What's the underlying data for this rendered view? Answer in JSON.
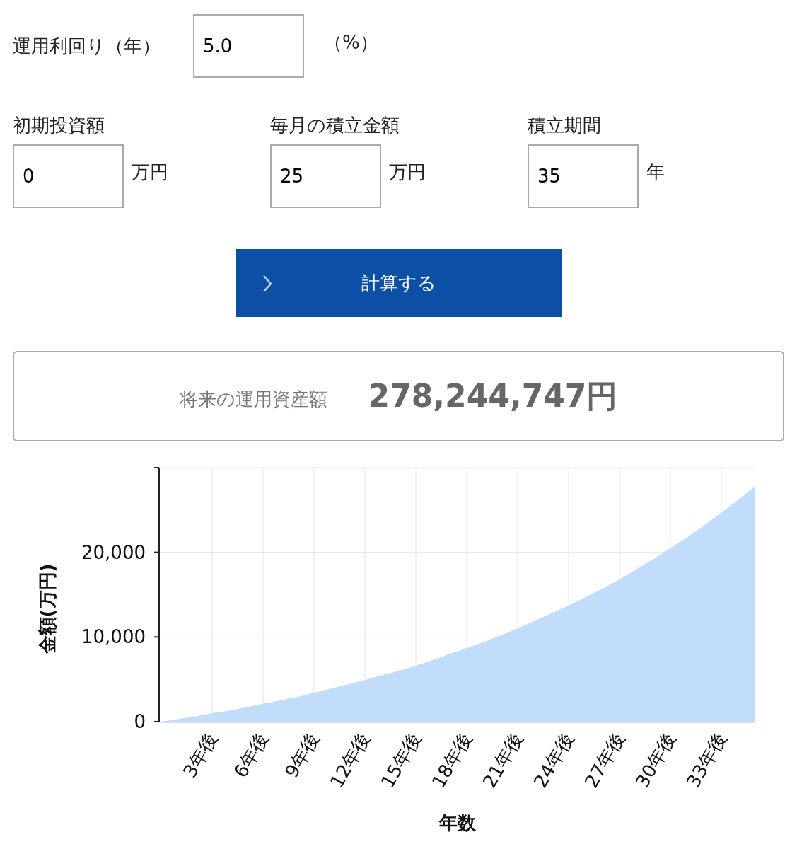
{
  "rate": {
    "label": "運用利回り（年）",
    "value": "5.0",
    "unit": "（%）"
  },
  "fields": [
    {
      "label": "初期投資額",
      "value": "0",
      "unit": "万円"
    },
    {
      "label": "毎月の積立金額",
      "value": "25",
      "unit": "万円"
    },
    {
      "label": "積立期間",
      "value": "35",
      "unit": "年"
    }
  ],
  "button": {
    "label": "計算する"
  },
  "result": {
    "label": "将来の運用資産額",
    "value": "278,244,747円"
  },
  "chart_data": {
    "type": "area",
    "xlabel": "年数",
    "ylabel": "金額(万円)",
    "x": [
      0,
      1,
      2,
      3,
      4,
      5,
      6,
      7,
      8,
      9,
      10,
      11,
      12,
      13,
      14,
      15,
      16,
      17,
      18,
      19,
      20,
      21,
      22,
      23,
      24,
      25,
      26,
      27,
      28,
      29,
      30,
      31,
      32,
      33,
      34,
      35
    ],
    "series": [
      {
        "color": "#c2dcfb",
        "values": [
          0,
          300,
          600,
          1000,
          1300,
          1700,
          2100,
          2500,
          2900,
          3400,
          3900,
          4400,
          4900,
          5500,
          6000,
          6600,
          7300,
          8000,
          8700,
          9400,
          10200,
          11000,
          11900,
          12800,
          13700,
          14700,
          15700,
          16800,
          18000,
          19200,
          20500,
          21800,
          23200,
          24700,
          26200,
          27800
        ]
      }
    ],
    "grid": true,
    "xlim": [
      0,
      35
    ],
    "ylim": [
      0,
      30000
    ],
    "xticks": [
      {
        "value": 3,
        "label": "3年後"
      },
      {
        "value": 6,
        "label": "6年後"
      },
      {
        "value": 9,
        "label": "9年後"
      },
      {
        "value": 12,
        "label": "12年後"
      },
      {
        "value": 15,
        "label": "15年後"
      },
      {
        "value": 18,
        "label": "18年後"
      },
      {
        "value": 21,
        "label": "21年後"
      },
      {
        "value": 24,
        "label": "24年後"
      },
      {
        "value": 27,
        "label": "27年後"
      },
      {
        "value": 30,
        "label": "30年後"
      },
      {
        "value": 33,
        "label": "33年後"
      }
    ],
    "yticks": [
      {
        "value": 0,
        "label": "0"
      },
      {
        "value": 10000,
        "label": "10,000"
      },
      {
        "value": 20000,
        "label": "20,000"
      }
    ]
  }
}
